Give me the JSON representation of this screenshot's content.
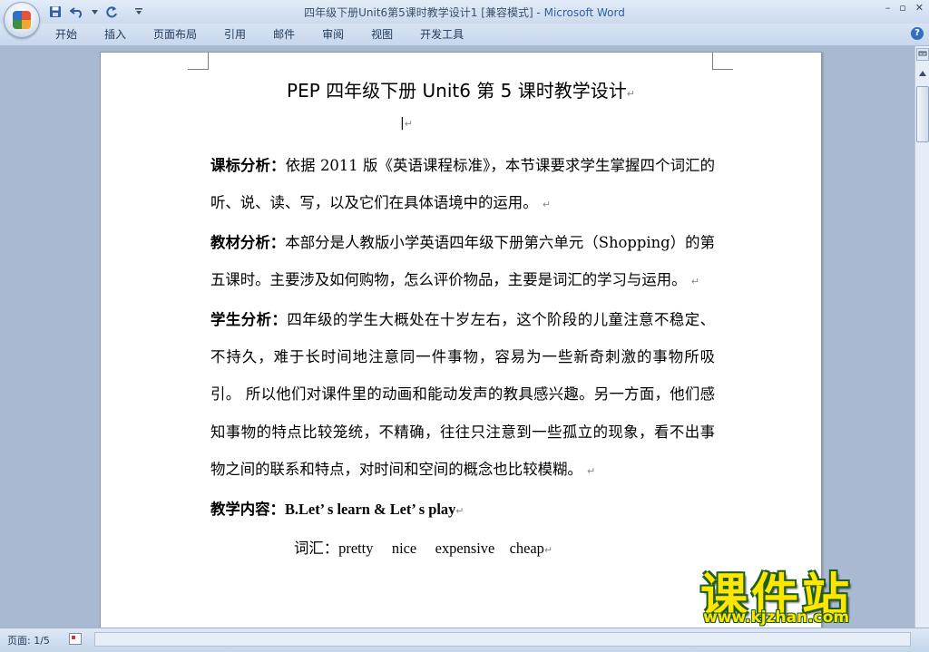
{
  "window": {
    "title_doc": "四年级下册Unit6第5课时教学设计1 [兼容模式] - ",
    "title_app": "Microsoft Word",
    "controls": [
      "–",
      "▫",
      "✕"
    ]
  },
  "ribbon": {
    "tabs": [
      "开始",
      "插入",
      "页面布局",
      "引用",
      "邮件",
      "审阅",
      "视图",
      "开发工具"
    ],
    "help": "?"
  },
  "document": {
    "title": "PEP 四年级下册 Unit6 第 5 课时教学设计",
    "paragraph_mark": "↵",
    "caret": "|",
    "sections": [
      {
        "label": "课标分析：",
        "text": "依据 2011 版《英语课程标准》，本节课要求学生掌握四个词汇的听、说、读、写，以及它们在具体语境中的运用。"
      },
      {
        "label": "教材分析：",
        "text": "本部分是人教版小学英语四年级下册第六单元（Shopping）的第五课时。主要涉及如何购物，怎么评价物品，主要是词汇的学习与运用。"
      },
      {
        "label": "学生分析：",
        "text": "四年级的学生大概处在十岁左右，这个阶段的儿童注意不稳定、不持久，难于长时间地注意同一件事物，容易为一些新奇刺激的事物所吸引。 所以他们对课件里的动画和能动发声的教具感兴趣。另一方面，他们感知事物的特点比较笼统，不精确，往往只注意到一些孤立的现象，看不出事物之间的联系和特点，对时间和空间的概念也比较模糊。"
      },
      {
        "label": "教学内容：",
        "text": "B.Let’ s learn & Let’ s play"
      }
    ],
    "vocab_line": "词汇：pretty     nice     expensive    cheap"
  },
  "watermark": {
    "logo": "课件站",
    "url": "www.kjzhan.com"
  },
  "status": {
    "page": "页面: 1/5"
  }
}
